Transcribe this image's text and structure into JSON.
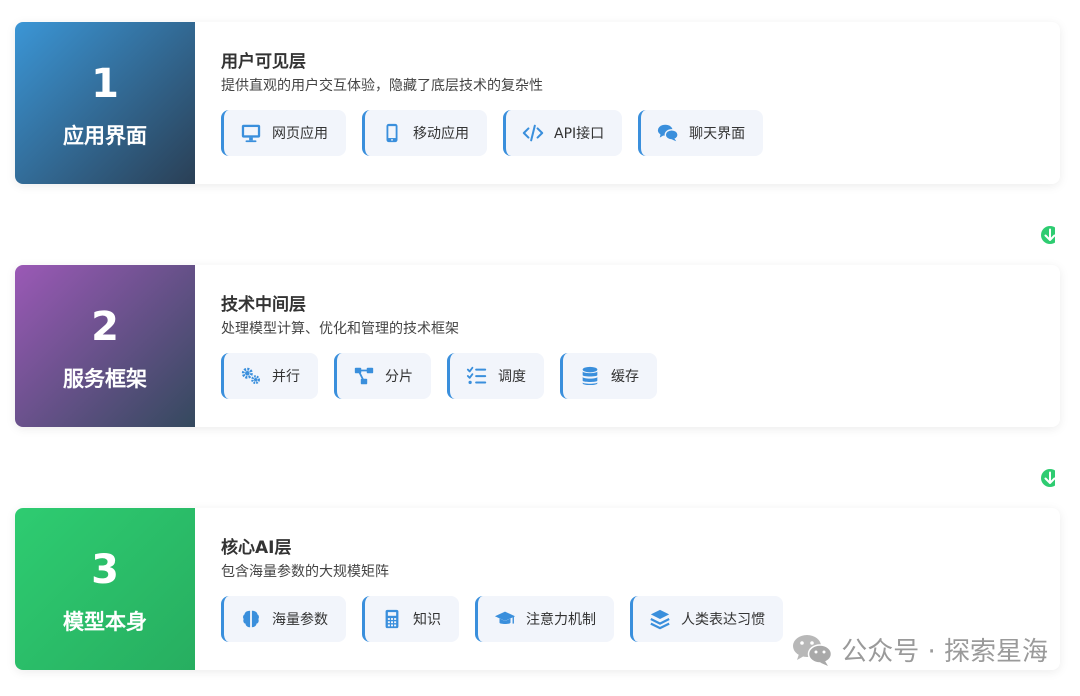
{
  "layers": [
    {
      "number": "1",
      "name": "应用界面",
      "title": "用户可见层",
      "description": "提供直观的用户交互体验，隐藏了底层技术的复杂性",
      "gradient": [
        "#3b96d6",
        "#2a3f55"
      ],
      "items": [
        {
          "icon": "monitor-icon",
          "label": "网页应用"
        },
        {
          "icon": "mobile-icon",
          "label": "移动应用"
        },
        {
          "icon": "code-icon",
          "label": "API接口"
        },
        {
          "icon": "chat-icon",
          "label": "聊天界面"
        }
      ]
    },
    {
      "number": "2",
      "name": "服务框架",
      "title": "技术中间层",
      "description": "处理模型计算、优化和管理的技术框架",
      "gradient": [
        "#9b59b6",
        "#34495e"
      ],
      "items": [
        {
          "icon": "gears-icon",
          "label": "并行"
        },
        {
          "icon": "network-icon",
          "label": "分片"
        },
        {
          "icon": "tasks-icon",
          "label": "调度"
        },
        {
          "icon": "database-icon",
          "label": "缓存"
        }
      ]
    },
    {
      "number": "3",
      "name": "模型本身",
      "title": "核心AI层",
      "description": "包含海量参数的大规模矩阵",
      "gradient": [
        "#2ecc71",
        "#27ae60"
      ],
      "items": [
        {
          "icon": "brain-icon",
          "label": "海量参数"
        },
        {
          "icon": "calculator-icon",
          "label": "知识"
        },
        {
          "icon": "graduation-cap-icon",
          "label": "注意力机制"
        },
        {
          "icon": "layers-icon",
          "label": "人类表达习惯"
        }
      ]
    }
  ],
  "colors": {
    "accent": "#3a8fdc",
    "chip_bg": "#f2f5fb",
    "arrow": "#2ecc71",
    "connector": [
      "#3a8fdc",
      "#9b59b6",
      "#2ecc71"
    ]
  },
  "watermark": {
    "text": "公众号 · 探索星海",
    "icon": "wechat-icon"
  }
}
